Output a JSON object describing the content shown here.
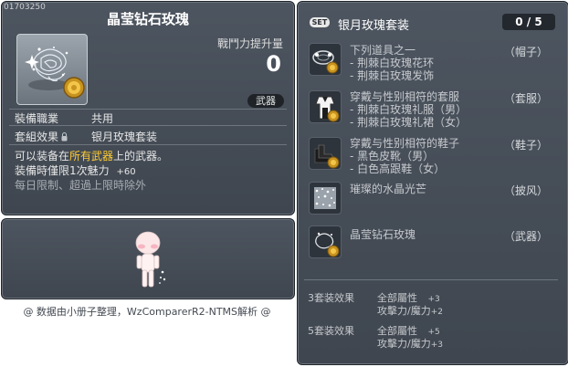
{
  "item": {
    "id": "01703250",
    "title": "晶莹钻石玫瑰",
    "power_label": "戰鬥力提升量",
    "power_value": "0",
    "type_badge": "武器",
    "job_label": "裝備職業",
    "job_value": "共用",
    "set_label": "套組效果",
    "set_value": "银月玫瑰套装",
    "desc_prefix": "可以装备在",
    "desc_highlight": "所有武器",
    "desc_suffix": "上的武器。",
    "limit_text": "装備時僅限1次魅力",
    "limit_value": "+60",
    "daily_note": "每日限制、超過上限時除外"
  },
  "set": {
    "badge": "SET",
    "name": "银月玫瑰套装",
    "count": "0 / 5",
    "pieces": [
      {
        "icon": "rose-wreath-icon",
        "lines": [
          "下列道具之一",
          "- 荆棘白玫瑰花环",
          "- 荆棘白玫瑰发饰"
        ],
        "type": "（帽子）"
      },
      {
        "icon": "suit-icon",
        "lines": [
          "穿戴与性别相符的套服",
          "- 荆棘白玫瑰礼服（男）",
          "- 荆棘白玫瑰礼裙（女）"
        ],
        "type": "（套服）"
      },
      {
        "icon": "shoes-icon",
        "lines": [
          "穿戴与性别相符的鞋子",
          "- 黑色皮靴（男）",
          "- 白色高跟鞋（女）"
        ],
        "type": "（鞋子）"
      },
      {
        "icon": "crystal-cape-icon",
        "lines": [
          "璀璨的水晶光芒"
        ],
        "type": "（披风）"
      },
      {
        "icon": "diamond-rose-icon",
        "lines": [
          "晶莹钻石玫瑰"
        ],
        "type": "（武器）"
      }
    ],
    "effects": [
      {
        "label": "3套装效果",
        "stats": [
          {
            "name": "全部屬性",
            "value": "+3"
          },
          {
            "name": "攻擊力/魔力",
            "value": "+2"
          }
        ]
      },
      {
        "label": "5套装效果",
        "stats": [
          {
            "name": "全部屬性",
            "value": "+5"
          },
          {
            "name": "攻擊力/魔力",
            "value": "+3"
          }
        ]
      }
    ]
  },
  "footer": "@ 数据由小册子整理，WzComparerR2-NTMS解析 @",
  "colors": {
    "panel": "#474e57",
    "highlight": "#ffcc33",
    "text": "#e8e8e8"
  }
}
